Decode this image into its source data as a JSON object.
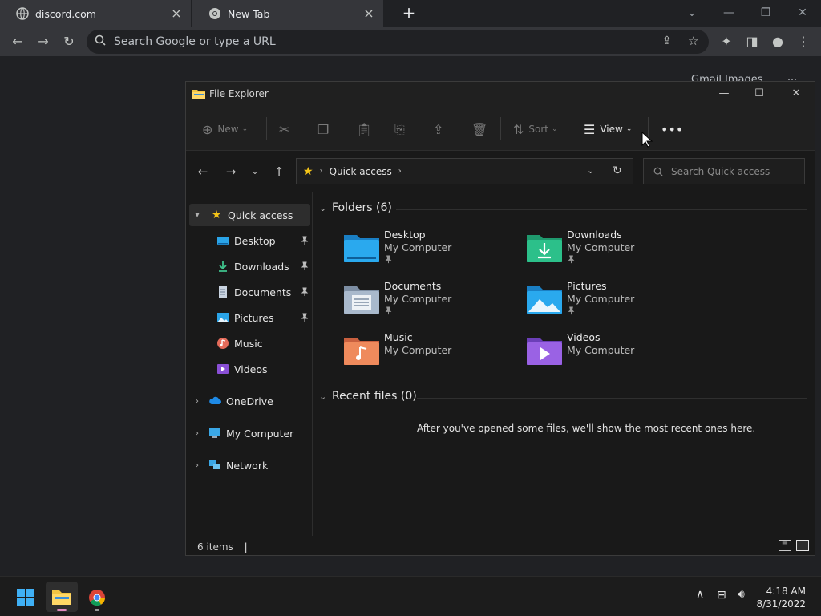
{
  "browser": {
    "tabs": [
      {
        "label": "discord.com"
      },
      {
        "label": "New Tab"
      }
    ],
    "omnibox_placeholder": "Search Google or type a URL",
    "page_links": "Gmail  Images"
  },
  "explorer": {
    "title": "File Explorer",
    "commands": {
      "new": "New",
      "sort": "Sort",
      "view": "View"
    },
    "address": {
      "location": "Quick access"
    },
    "search_placeholder": "Search Quick access",
    "nav": {
      "quick_access": "Quick access",
      "pinned": [
        {
          "label": "Desktop"
        },
        {
          "label": "Downloads"
        },
        {
          "label": "Documents"
        },
        {
          "label": "Pictures"
        },
        {
          "label": "Music"
        },
        {
          "label": "Videos"
        }
      ],
      "onedrive": "OneDrive",
      "my_computer": "My Computer",
      "network": "Network"
    },
    "folders_header": "Folders (6)",
    "folders": [
      {
        "name": "Desktop",
        "location": "My Computer"
      },
      {
        "name": "Downloads",
        "location": "My Computer"
      },
      {
        "name": "Documents",
        "location": "My Computer"
      },
      {
        "name": "Pictures",
        "location": "My Computer"
      },
      {
        "name": "Music",
        "location": "My Computer"
      },
      {
        "name": "Videos",
        "location": "My Computer"
      }
    ],
    "recent_header": "Recent files (0)",
    "recent_message": "After you've opened some files, we'll show the most recent ones here.",
    "status": "6 items"
  },
  "taskbar": {
    "time": "4:18 AM",
    "date": "8/31/2022"
  }
}
